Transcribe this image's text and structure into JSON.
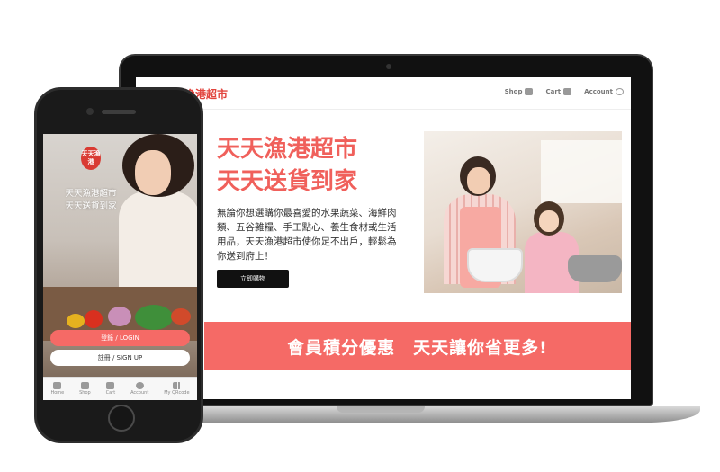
{
  "laptop": {
    "header": {
      "logo_text": "天天漁港超市",
      "nav": [
        {
          "label": "Shop",
          "icon": "shop-icon"
        },
        {
          "label": "Cart",
          "icon": "cart-icon"
        },
        {
          "label": "Account",
          "icon": "account-icon"
        }
      ]
    },
    "hero": {
      "title_line1": "天天漁港超市",
      "title_line2": "天天送貨到家",
      "body": "無論你想選購你最喜愛的水果蔬菜、海鮮肉類、五谷雜糧、手工點心、養生食材或生活用品，天天漁港超市使你足不出戶，輕鬆為你送到府上！",
      "cta_label": "立即購物"
    },
    "banner_text": "會員積分優惠　天天讓你省更多!"
  },
  "phone": {
    "logo_text": "天天漁港",
    "tagline_line1": "天天漁港超市",
    "tagline_line2": "天天送貨到家",
    "login_label": "登錄 / LOGIN",
    "signup_label": "註冊 / SIGN UP",
    "tabs": [
      {
        "label": "Home",
        "icon": "home-icon"
      },
      {
        "label": "Shop",
        "icon": "shop-icon"
      },
      {
        "label": "Cart",
        "icon": "cart-icon"
      },
      {
        "label": "Account",
        "icon": "account-icon"
      },
      {
        "label": "My QRcode",
        "icon": "qrcode-icon"
      }
    ]
  },
  "colors": {
    "accent": "#f56a66",
    "brand_red": "#e2453e",
    "button_dark": "#111111"
  }
}
